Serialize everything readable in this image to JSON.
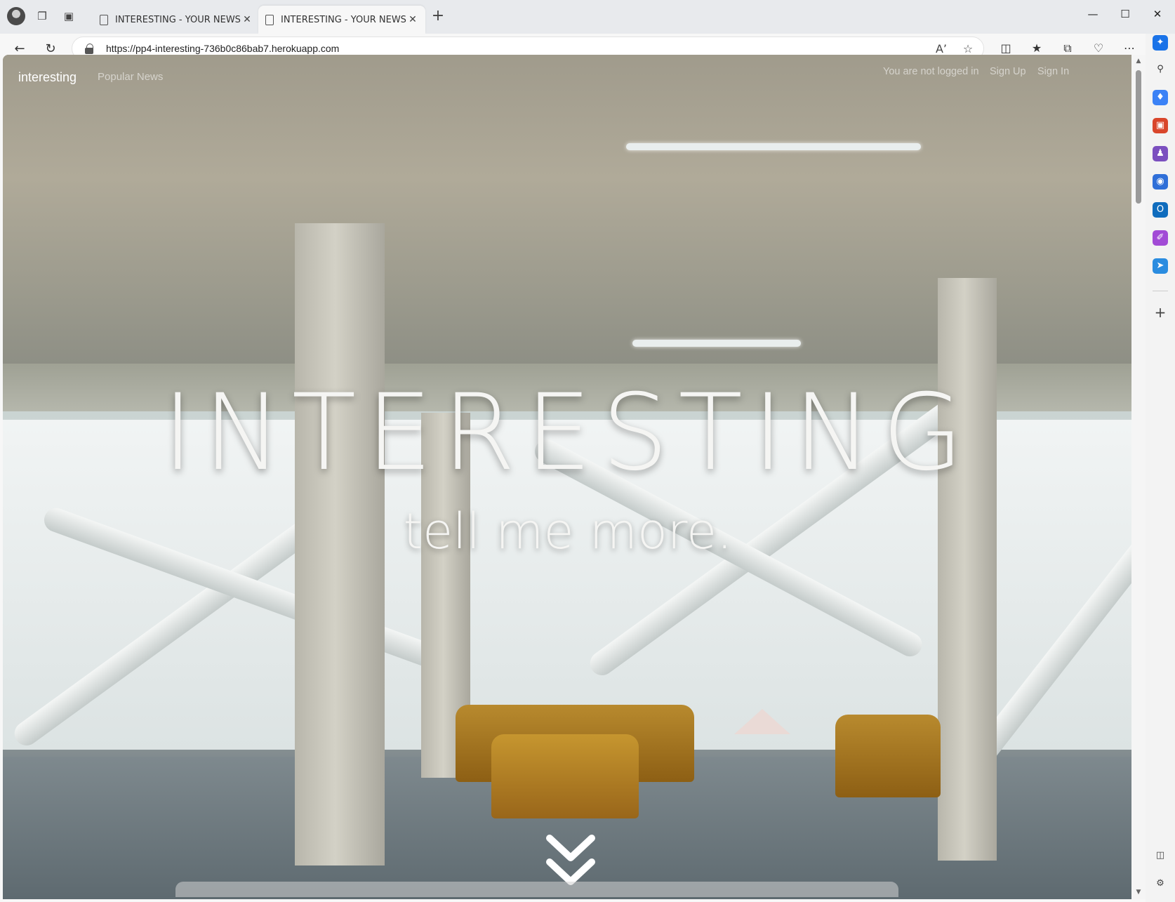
{
  "browser": {
    "tabs": [
      {
        "title": "INTERESTING - YOUR NEWS FIX",
        "active": false
      },
      {
        "title": "INTERESTING - YOUR NEWS FIX",
        "active": true
      }
    ],
    "url": "https://pp4-interesting-736b0c86bab7.herokuapp.com"
  },
  "site": {
    "brand": "interesting",
    "nav_popular": "Popular News",
    "status": "You are not logged in",
    "signup": "Sign Up",
    "signin": "Sign In"
  },
  "hero": {
    "title": "INTERESTING",
    "subtitle": "tell me more."
  },
  "sidebar_icons": [
    "search-icon",
    "tag-icon",
    "briefcase-icon",
    "games-icon",
    "office-icon",
    "outlook-icon",
    "designer-icon",
    "send-icon",
    "add-icon"
  ]
}
